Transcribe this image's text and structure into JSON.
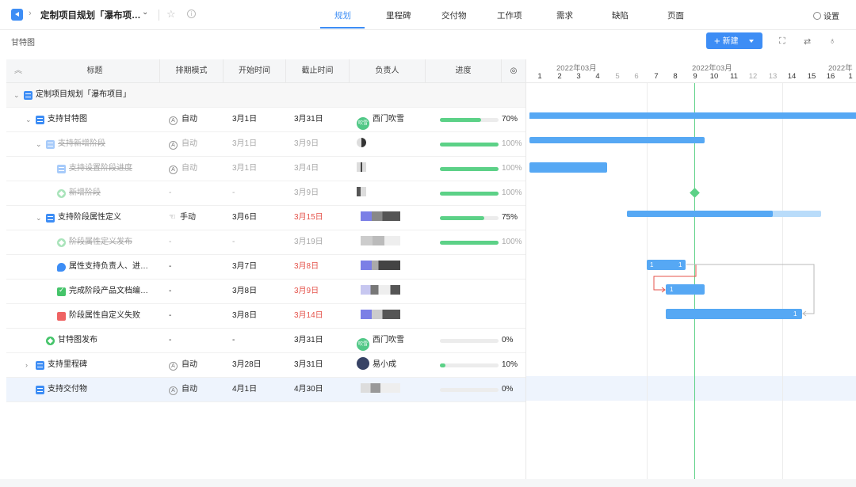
{
  "topbar": {
    "project_title": "定制项目规划「瀑布项…",
    "tabs": [
      {
        "label": "规划",
        "active": true
      },
      {
        "label": "里程碑"
      },
      {
        "label": "交付物"
      },
      {
        "label": "工作项"
      },
      {
        "label": "需求"
      },
      {
        "label": "缺陷"
      },
      {
        "label": "页面"
      }
    ],
    "settings_label": "设置",
    "accent": "#3d8df5"
  },
  "subbar": {
    "view_title": "甘特图",
    "new_label": "新建"
  },
  "grid": {
    "columns": [
      "标题",
      "排期模式",
      "开始时间",
      "截止时间",
      "负责人",
      "进度"
    ],
    "rows": [
      {
        "title": "定制项目规划「瀑布项目」",
        "mode": "",
        "start": "",
        "end": "",
        "owner": "",
        "progress": null,
        "pct": ""
      },
      {
        "title": "支持甘特图",
        "mode": "自动",
        "start": "3月1日",
        "end": "3月31日",
        "owner": "西门吹雪",
        "owner_avatar": "吹雪",
        "progress": 0.7,
        "pct": "70%"
      },
      {
        "title": "支持新增阶段",
        "mode": "自动",
        "start": "3月1日",
        "end": "3月9日",
        "owner": "",
        "progress": 1.0,
        "pct": "100%"
      },
      {
        "title": "支持设置阶段进度",
        "mode": "自动",
        "start": "3月1日",
        "end": "3月4日",
        "owner": "",
        "progress": 1.0,
        "pct": "100%"
      },
      {
        "title": "新增阶段",
        "mode": "-",
        "start": "-",
        "end": "3月9日",
        "owner": "",
        "progress": 1.0,
        "pct": "100%"
      },
      {
        "title": "支持阶段属性定义",
        "mode": "手动",
        "start": "3月6日",
        "end": "3月15日",
        "owner": "",
        "progress": 0.75,
        "pct": "75%"
      },
      {
        "title": "阶段属性定义发布",
        "mode": "-",
        "start": "-",
        "end": "3月19日",
        "owner": "",
        "progress": 1.0,
        "pct": "100%"
      },
      {
        "title": "属性支持负责人、进…",
        "mode": "-",
        "start": "3月7日",
        "end": "3月8日",
        "owner": "",
        "progress": null,
        "pct": ""
      },
      {
        "title": "完成阶段产品文档编…",
        "mode": "-",
        "start": "3月8日",
        "end": "3月9日",
        "owner": "",
        "progress": null,
        "pct": ""
      },
      {
        "title": "阶段属性自定义失败",
        "mode": "-",
        "start": "3月8日",
        "end": "3月14日",
        "owner": "",
        "progress": null,
        "pct": ""
      },
      {
        "title": "甘特图发布",
        "mode": "-",
        "start": "-",
        "end": "3月31日",
        "owner": "西门吹雪",
        "owner_avatar": "吹雪",
        "progress": 0.0,
        "pct": "0%"
      },
      {
        "title": "支持里程碑",
        "mode": "自动",
        "start": "3月28日",
        "end": "3月31日",
        "owner": "易小成",
        "progress": 0.1,
        "pct": "10%"
      },
      {
        "title": "支持交付物",
        "mode": "自动",
        "start": "4月1日",
        "end": "4月30日",
        "owner": "",
        "progress": 0.0,
        "pct": "0%"
      }
    ]
  },
  "gantt": {
    "months": [
      "2022年03月",
      "2022年03月",
      "2022年"
    ],
    "days": [
      "1",
      "2",
      "3",
      "4",
      "5",
      "6",
      "7",
      "8",
      "9",
      "10",
      "11",
      "12",
      "13",
      "14",
      "15",
      "16",
      "1"
    ],
    "bar_numbers": [
      "1",
      "1",
      "1",
      "1"
    ]
  }
}
